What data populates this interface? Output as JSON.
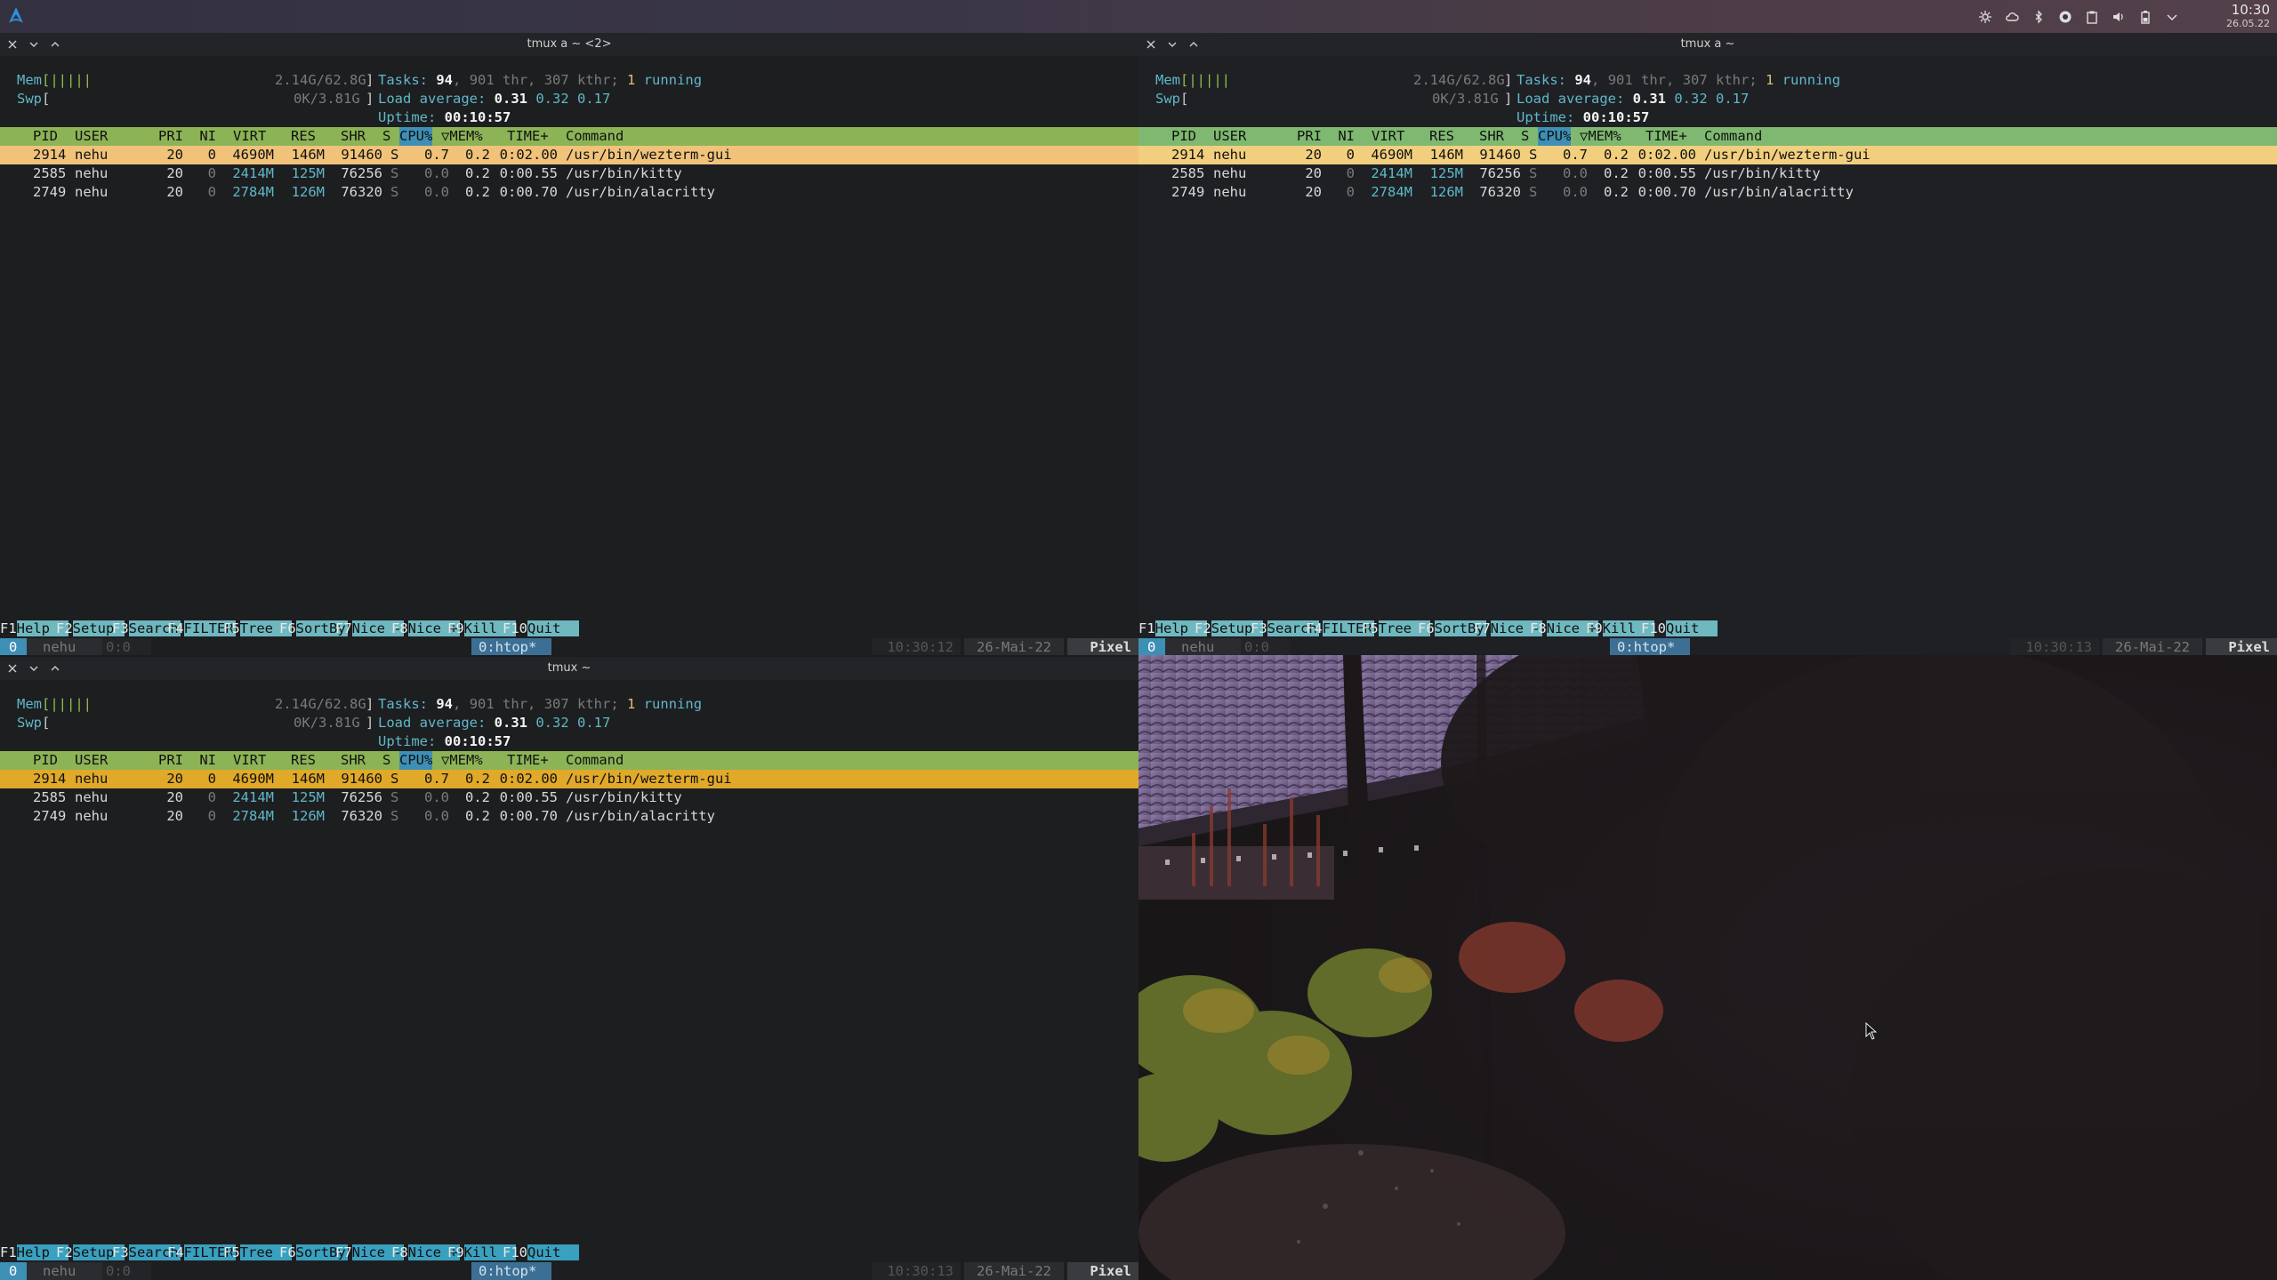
{
  "topbar": {
    "launcher_icon": "arch-logo-icon",
    "tray_icons": [
      "settings-icon",
      "cloud-icon",
      "bluetooth-icon",
      "update-icon",
      "clipboard-icon",
      "volume-icon",
      "battery-icon",
      "chevron-down-icon"
    ],
    "clock_time": "10:30",
    "clock_date": "26.05.22"
  },
  "htop": {
    "mem_label": "Mem",
    "mem_bar": "[|||||",
    "mem_value": "2.14G/62.8G",
    "swp_label": "Swp",
    "swp_bar": "[",
    "swp_value": "0K/3.81G",
    "tasks_label": "Tasks:",
    "tasks_count": "94",
    "thr": "901 thr,",
    "kthr": "307 kthr;",
    "running_count": "1",
    "running_label": "running",
    "load_label": "Load average:",
    "load1": "0.31",
    "load5": "0.32",
    "load15": "0.17",
    "uptime_label": "Uptime:",
    "uptime": "00:10:57",
    "columns": [
      "PID",
      "USER",
      "PRI",
      "NI",
      "VIRT",
      "RES",
      "SHR",
      "S",
      "CPU%",
      "▽MEM%",
      "TIME+",
      "Command"
    ],
    "processes": [
      {
        "pid": "2914",
        "user": "nehu",
        "pri": "20",
        "ni": "0",
        "virt": "4690M",
        "res": "146M",
        "shr": "91460",
        "s": "S",
        "cpu": "0.7",
        "mem": "0.2",
        "time": "0:02.00",
        "cmd": "/usr/bin/wezterm-gui"
      },
      {
        "pid": "2585",
        "user": "nehu",
        "pri": "20",
        "ni": "0",
        "virt": "2414M",
        "res": "125M",
        "shr": "76256",
        "s": "S",
        "cpu": "0.0",
        "mem": "0.2",
        "time": "0:00.55",
        "cmd": "/usr/bin/kitty"
      },
      {
        "pid": "2749",
        "user": "nehu",
        "pri": "20",
        "ni": "0",
        "virt": "2784M",
        "res": "126M",
        "shr": "76320",
        "s": "S",
        "cpu": "0.0",
        "mem": "0.2",
        "time": "0:00.70",
        "cmd": "/usr/bin/alacritty"
      }
    ],
    "fkeys": [
      {
        "key": "F1",
        "label": "Help  "
      },
      {
        "key": "F2",
        "label": "Setup "
      },
      {
        "key": "F3",
        "label": "Search"
      },
      {
        "key": "F4",
        "label": "FILTER"
      },
      {
        "key": "F5",
        "label": "Tree  "
      },
      {
        "key": "F6",
        "label": "SortBy"
      },
      {
        "key": "F7",
        "label": "Nice -"
      },
      {
        "key": "F8",
        "label": "Nice +"
      },
      {
        "key": "F9",
        "label": "Kill  "
      },
      {
        "key": "F10",
        "label": "Quit  "
      }
    ]
  },
  "windows": [
    {
      "title": "tmux a ~ <2>",
      "status": {
        "session": "0",
        "user": "nehu",
        "pane": "0:0",
        "window": "0:htop*",
        "time": "10:30:12",
        "date": "26-Mai-22",
        "host": "Pixel"
      }
    },
    {
      "title": "tmux a ~",
      "status": {
        "session": "0",
        "user": "nehu",
        "pane": "0:0",
        "window": "0:htop*",
        "time": "10:30:13",
        "date": "26-Mai-22",
        "host": "Pixel"
      }
    },
    {
      "title": "tmux ~",
      "status": {
        "session": "0",
        "user": "nehu",
        "pane": "0:0",
        "window": "0:htop*",
        "time": "10:30:13",
        "date": "26-Mai-22",
        "host": "Pixel"
      }
    }
  ],
  "colors": {
    "header_green": "#8cb356",
    "selection_orange": "#f0c27a",
    "fkey_cyan": "#6fb8c0",
    "tmux_blue": "#3d8fb5"
  }
}
